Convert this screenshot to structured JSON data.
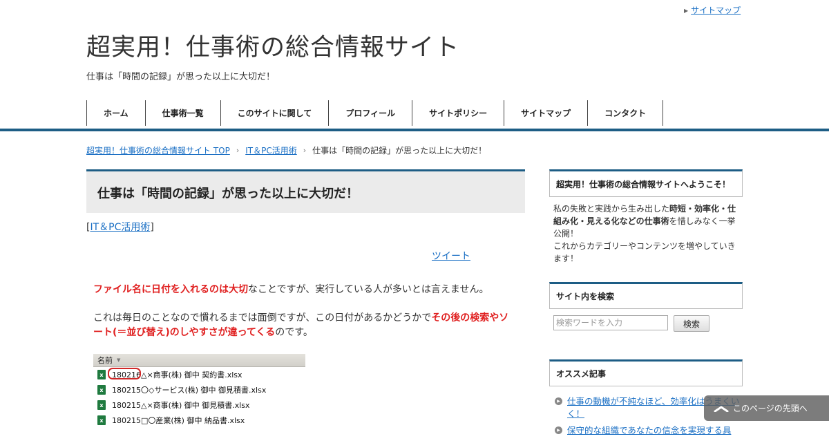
{
  "header": {
    "sitemap_link": "サイトマップ",
    "site_title": "超実用！仕事術の総合情報サイト",
    "site_description": "仕事は「時間の記録」が思った以上に大切だ！"
  },
  "nav": {
    "items": [
      "ホーム",
      "仕事術一覧",
      "このサイトに関して",
      "プロフィール",
      "サイトポリシー",
      "サイトマップ",
      "コンタクト"
    ]
  },
  "breadcrumb": {
    "home": "超実用！仕事術の総合情報サイト TOP",
    "category": "IT＆PC活用術",
    "current": "仕事は「時間の記録」が思った以上に大切だ！"
  },
  "article": {
    "title": "仕事は「時間の記録」が思った以上に大切だ！",
    "category_open": "[",
    "category_link": "IT＆PC活用術",
    "category_close": "]",
    "tweet_label": "ツイート",
    "para1_red": "ファイル名に日付を入れるのは大切",
    "para1_rest": "なことですが、実行している人が多いとは言えません。",
    "para2_start": "これは毎日のことなので慣れるまでは面倒ですが、この日付があるかどうかで",
    "para2_red": "その後の検索やソート(＝並び替え)のしやすさが違ってくる",
    "para2_end": "のです。"
  },
  "explorer": {
    "column_header": "名前",
    "files": [
      "180216△×商事(株) 御中 契約書.xlsx",
      "180215〇◇サービス(株) 御中 御見積書.xlsx",
      "180215△×商事(株) 御中 御見積書.xlsx",
      "180215□〇産業(株) 御中 納品書.xlsx"
    ]
  },
  "sidebar": {
    "welcome_title": "超実用！仕事術の総合情報サイトへようこそ！",
    "welcome_pre": "私の失敗と実践から生み出した",
    "welcome_bold": "時短・効率化・仕組み化・見える化などの仕事術",
    "welcome_post": "を惜しみなく一挙公開！",
    "welcome_line2": "これからカテゴリーやコンテンツを増やしていきます！",
    "search_title": "サイト内を検索",
    "search_placeholder": "検索ワードを入力",
    "search_button": "検索",
    "recommended_title": "オススメ記事",
    "recommended": [
      "仕事の動機が不純なほど、効率化はうまくいく！",
      "保守的な組織であなたの信念を実現する具"
    ]
  },
  "back_to_top": "このページの先頭へ",
  "colors": {
    "accent": "#1d5d85",
    "emphasis_red": "#e02020",
    "link": "#1a6fc4"
  }
}
